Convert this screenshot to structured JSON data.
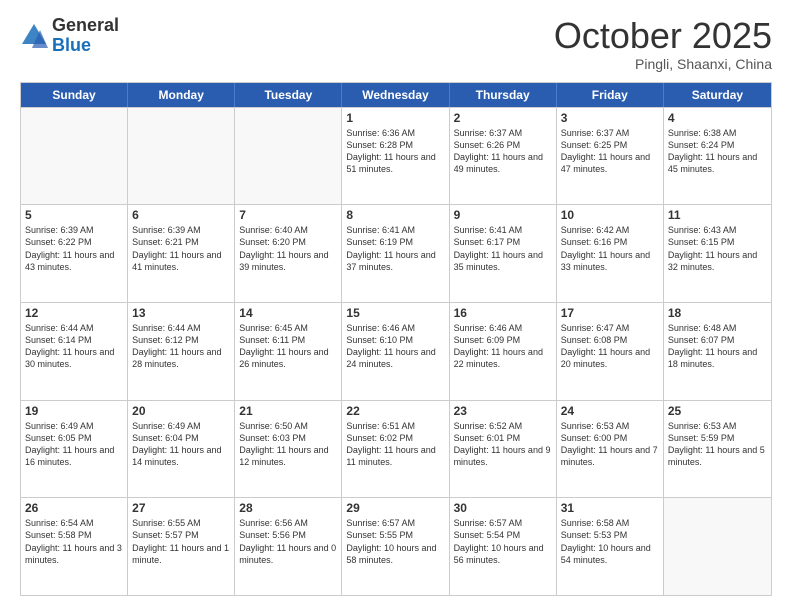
{
  "header": {
    "logo_general": "General",
    "logo_blue": "Blue",
    "month": "October 2025",
    "location": "Pingli, Shaanxi, China"
  },
  "days_of_week": [
    "Sunday",
    "Monday",
    "Tuesday",
    "Wednesday",
    "Thursday",
    "Friday",
    "Saturday"
  ],
  "weeks": [
    [
      {
        "day": "",
        "info": ""
      },
      {
        "day": "",
        "info": ""
      },
      {
        "day": "",
        "info": ""
      },
      {
        "day": "1",
        "info": "Sunrise: 6:36 AM\nSunset: 6:28 PM\nDaylight: 11 hours and 51 minutes."
      },
      {
        "day": "2",
        "info": "Sunrise: 6:37 AM\nSunset: 6:26 PM\nDaylight: 11 hours and 49 minutes."
      },
      {
        "day": "3",
        "info": "Sunrise: 6:37 AM\nSunset: 6:25 PM\nDaylight: 11 hours and 47 minutes."
      },
      {
        "day": "4",
        "info": "Sunrise: 6:38 AM\nSunset: 6:24 PM\nDaylight: 11 hours and 45 minutes."
      }
    ],
    [
      {
        "day": "5",
        "info": "Sunrise: 6:39 AM\nSunset: 6:22 PM\nDaylight: 11 hours and 43 minutes."
      },
      {
        "day": "6",
        "info": "Sunrise: 6:39 AM\nSunset: 6:21 PM\nDaylight: 11 hours and 41 minutes."
      },
      {
        "day": "7",
        "info": "Sunrise: 6:40 AM\nSunset: 6:20 PM\nDaylight: 11 hours and 39 minutes."
      },
      {
        "day": "8",
        "info": "Sunrise: 6:41 AM\nSunset: 6:19 PM\nDaylight: 11 hours and 37 minutes."
      },
      {
        "day": "9",
        "info": "Sunrise: 6:41 AM\nSunset: 6:17 PM\nDaylight: 11 hours and 35 minutes."
      },
      {
        "day": "10",
        "info": "Sunrise: 6:42 AM\nSunset: 6:16 PM\nDaylight: 11 hours and 33 minutes."
      },
      {
        "day": "11",
        "info": "Sunrise: 6:43 AM\nSunset: 6:15 PM\nDaylight: 11 hours and 32 minutes."
      }
    ],
    [
      {
        "day": "12",
        "info": "Sunrise: 6:44 AM\nSunset: 6:14 PM\nDaylight: 11 hours and 30 minutes."
      },
      {
        "day": "13",
        "info": "Sunrise: 6:44 AM\nSunset: 6:12 PM\nDaylight: 11 hours and 28 minutes."
      },
      {
        "day": "14",
        "info": "Sunrise: 6:45 AM\nSunset: 6:11 PM\nDaylight: 11 hours and 26 minutes."
      },
      {
        "day": "15",
        "info": "Sunrise: 6:46 AM\nSunset: 6:10 PM\nDaylight: 11 hours and 24 minutes."
      },
      {
        "day": "16",
        "info": "Sunrise: 6:46 AM\nSunset: 6:09 PM\nDaylight: 11 hours and 22 minutes."
      },
      {
        "day": "17",
        "info": "Sunrise: 6:47 AM\nSunset: 6:08 PM\nDaylight: 11 hours and 20 minutes."
      },
      {
        "day": "18",
        "info": "Sunrise: 6:48 AM\nSunset: 6:07 PM\nDaylight: 11 hours and 18 minutes."
      }
    ],
    [
      {
        "day": "19",
        "info": "Sunrise: 6:49 AM\nSunset: 6:05 PM\nDaylight: 11 hours and 16 minutes."
      },
      {
        "day": "20",
        "info": "Sunrise: 6:49 AM\nSunset: 6:04 PM\nDaylight: 11 hours and 14 minutes."
      },
      {
        "day": "21",
        "info": "Sunrise: 6:50 AM\nSunset: 6:03 PM\nDaylight: 11 hours and 12 minutes."
      },
      {
        "day": "22",
        "info": "Sunrise: 6:51 AM\nSunset: 6:02 PM\nDaylight: 11 hours and 11 minutes."
      },
      {
        "day": "23",
        "info": "Sunrise: 6:52 AM\nSunset: 6:01 PM\nDaylight: 11 hours and 9 minutes."
      },
      {
        "day": "24",
        "info": "Sunrise: 6:53 AM\nSunset: 6:00 PM\nDaylight: 11 hours and 7 minutes."
      },
      {
        "day": "25",
        "info": "Sunrise: 6:53 AM\nSunset: 5:59 PM\nDaylight: 11 hours and 5 minutes."
      }
    ],
    [
      {
        "day": "26",
        "info": "Sunrise: 6:54 AM\nSunset: 5:58 PM\nDaylight: 11 hours and 3 minutes."
      },
      {
        "day": "27",
        "info": "Sunrise: 6:55 AM\nSunset: 5:57 PM\nDaylight: 11 hours and 1 minute."
      },
      {
        "day": "28",
        "info": "Sunrise: 6:56 AM\nSunset: 5:56 PM\nDaylight: 11 hours and 0 minutes."
      },
      {
        "day": "29",
        "info": "Sunrise: 6:57 AM\nSunset: 5:55 PM\nDaylight: 10 hours and 58 minutes."
      },
      {
        "day": "30",
        "info": "Sunrise: 6:57 AM\nSunset: 5:54 PM\nDaylight: 10 hours and 56 minutes."
      },
      {
        "day": "31",
        "info": "Sunrise: 6:58 AM\nSunset: 5:53 PM\nDaylight: 10 hours and 54 minutes."
      },
      {
        "day": "",
        "info": ""
      }
    ]
  ]
}
